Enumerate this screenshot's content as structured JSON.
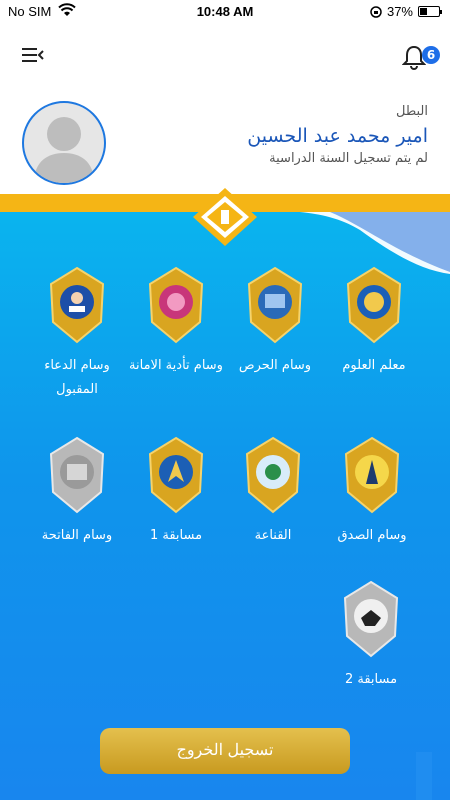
{
  "status_bar": {
    "carrier": "No SIM",
    "time": "10:48 AM",
    "battery": "37%"
  },
  "header": {
    "notification_count": "6",
    "icons": [
      "menu-icon",
      "bell-icon"
    ]
  },
  "profile": {
    "role": "البطل",
    "name": "امير محمد عبد الحسين",
    "note": "لم يتم تسجيل السنة الدراسية"
  },
  "medals": [
    {
      "label": "معلم العلوم",
      "color": "#d9a520"
    },
    {
      "label": "وسام الحرص",
      "color": "#d9a520"
    },
    {
      "label": "وسام تأدية الامانة",
      "color": "#d9a520"
    },
    {
      "label": "وسام الدعاء المقبول",
      "color": "#d9a520"
    },
    {
      "label": "وسام الصدق",
      "color": "#d9a520"
    },
    {
      "label": "القناعة",
      "color": "#d9a520"
    },
    {
      "label": "مسابقة 1",
      "color": "#d9a520"
    },
    {
      "label": "وسام الفاتحة",
      "color": "#b8b8b8"
    },
    {
      "label": "مسابقة 2",
      "color": "#b8b8b8"
    }
  ],
  "logout_label": "تسجيل الخروج",
  "colors": {
    "gold": "#f5b515",
    "blue": "#0f95ec",
    "name": "#1a56b8"
  }
}
